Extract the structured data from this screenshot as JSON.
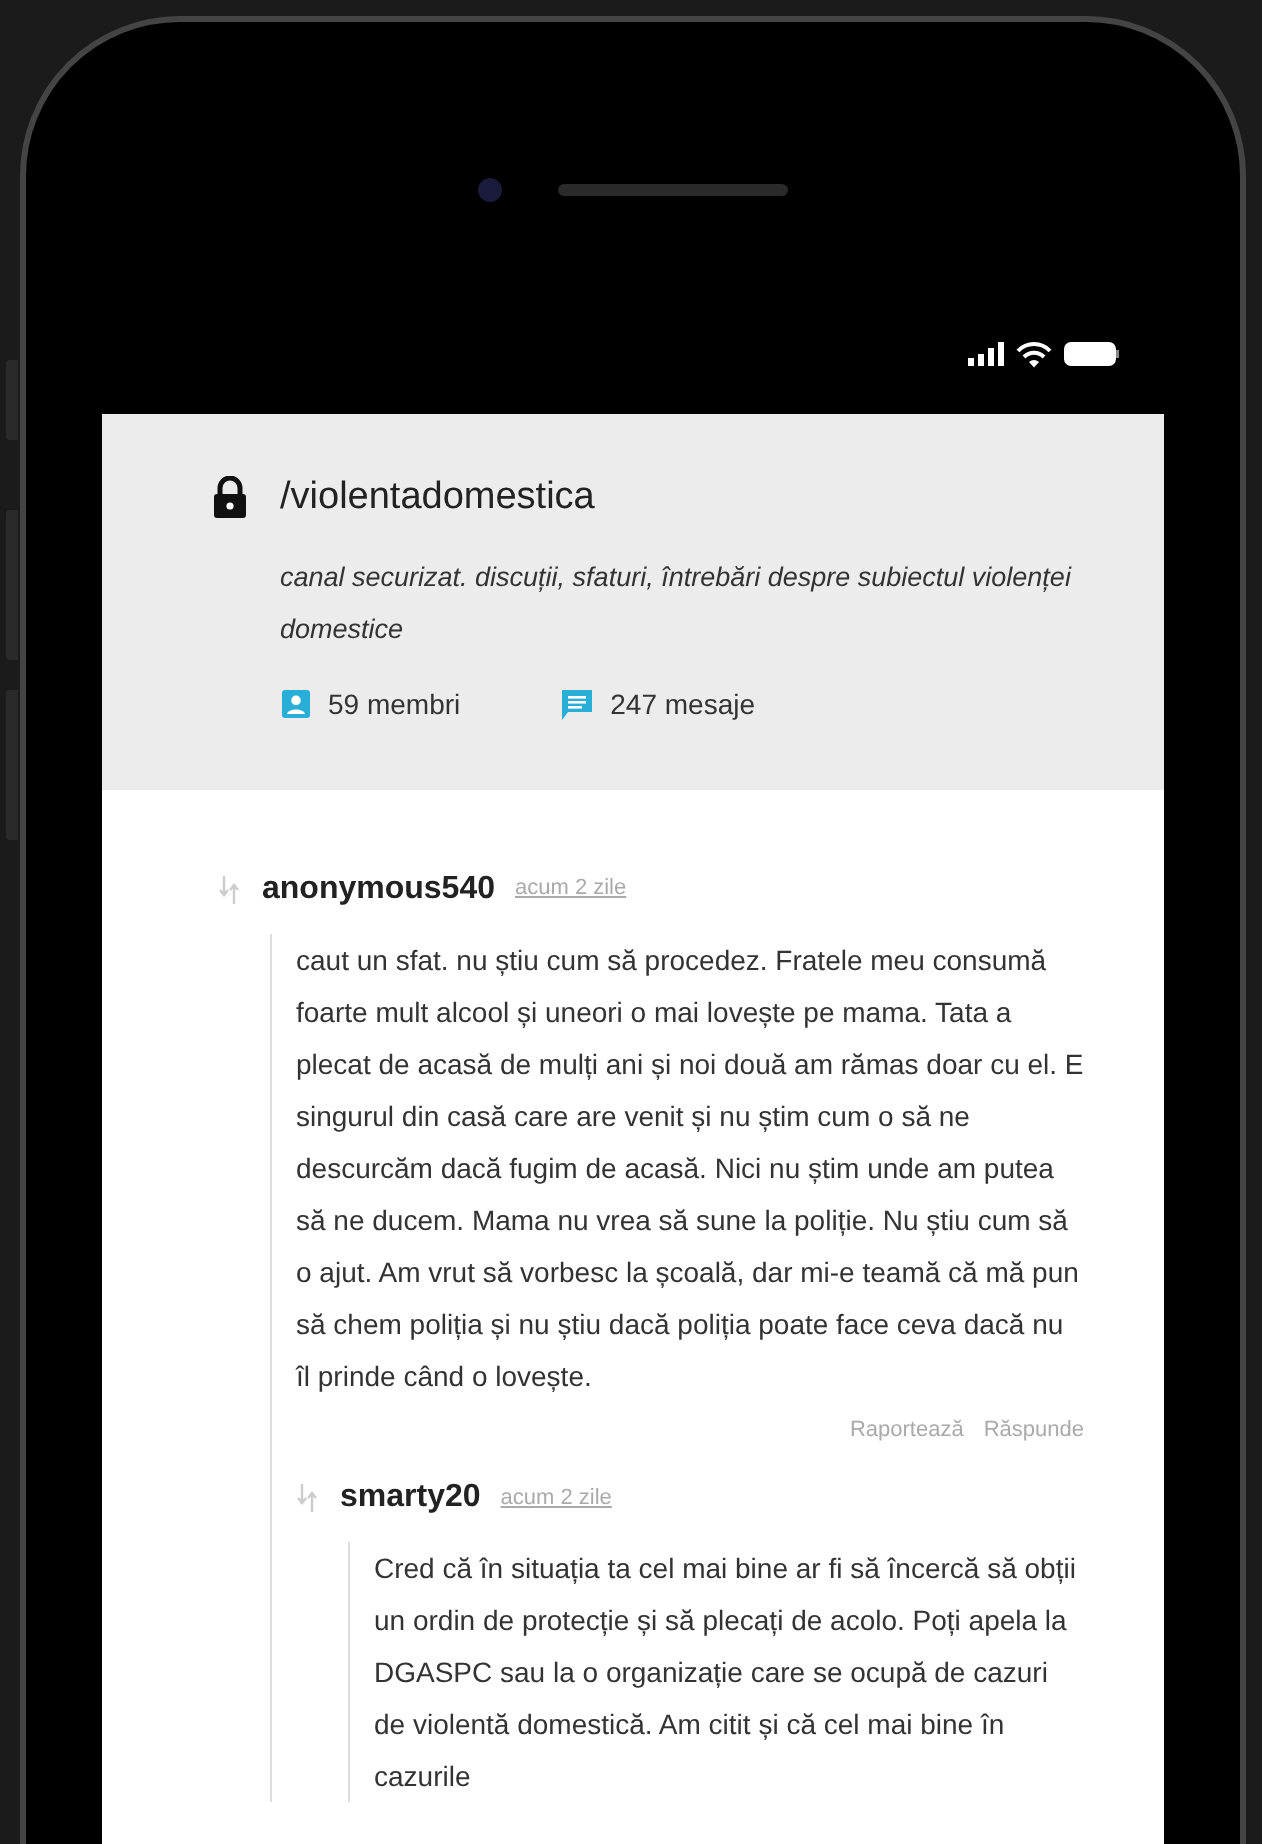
{
  "channel": {
    "name": "/violentadomestica",
    "locked": true,
    "description": "canal securizat. discuții, sfaturi, întrebări despre subiectul violenței domestice",
    "stats": [
      {
        "kind": "members",
        "text": "59 membri"
      },
      {
        "kind": "messages",
        "text": "247 mesaje"
      }
    ]
  },
  "comments": [
    {
      "author": "anonymous540",
      "time": "acum 2 zile",
      "body": "caut un sfat. nu știu cum să procedez. Fratele meu consumă foarte mult alcool și uneori o mai lovește pe mama. Tata a plecat de acasă de mulți ani și noi două am rămas doar cu el. E singurul din casă care are venit și nu știm cum o să ne descurcăm dacă fugim de acasă. Nici nu știm unde am putea să ne ducem. Mama nu vrea să sune la poliție. Nu știu cum să o ajut. Am vrut să vorbesc la școală, dar mi-e teamă că mă pun să chem poliția și nu știu dacă poliția poate face ceva dacă nu îl prinde când o lovește.",
      "actions": [
        "Raportează",
        "Răspunde"
      ],
      "children": [
        {
          "author": "smarty20",
          "time": "acum 2 zile",
          "body": "Cred că în situația ta cel mai bine ar fi să încercă să obții un ordin de protecție și să plecați de acolo. Poți apela la DGASPC sau la o organizație care se ocupă de cazuri de violentă domestică. Am citit și că cel mai bine în cazurile"
        }
      ]
    }
  ]
}
